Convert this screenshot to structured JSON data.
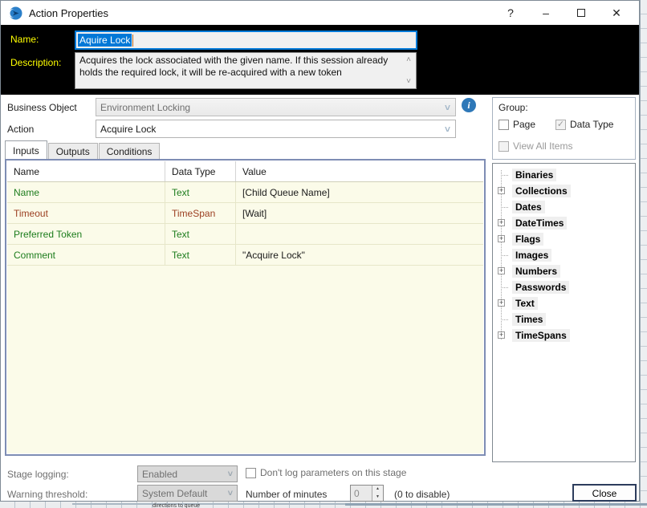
{
  "window": {
    "title": "Action Properties",
    "help": "?",
    "minimize": "–",
    "close": "✕"
  },
  "header": {
    "name_label": "Name:",
    "name_value": "Aquire Lock",
    "description_label": "Description:",
    "description_value": "Acquires the lock associated with the given name. If this session already holds the required lock, it will be re-acquired with a new token"
  },
  "form": {
    "business_object_label": "Business Object",
    "business_object_value": "Environment Locking",
    "action_label": "Action",
    "action_value": "Acquire Lock"
  },
  "tabs": [
    {
      "label": "Inputs",
      "active": true
    },
    {
      "label": "Outputs",
      "active": false
    },
    {
      "label": "Conditions",
      "active": false
    }
  ],
  "inputs_table": {
    "columns": [
      "Name",
      "Data Type",
      "Value"
    ],
    "rows": [
      {
        "name": "Name",
        "type": "Text",
        "value": "[Child Queue Name]",
        "color": "green"
      },
      {
        "name": "Timeout",
        "type": "TimeSpan",
        "value": "[Wait]",
        "color": "maroon"
      },
      {
        "name": "Preferred Token",
        "type": "Text",
        "value": "",
        "color": "green"
      },
      {
        "name": "Comment",
        "type": "Text",
        "value": "\"Acquire Lock\"",
        "color": "green"
      }
    ]
  },
  "group_panel": {
    "title": "Group:",
    "checkboxes": [
      {
        "label": "Page",
        "checked": false,
        "disabled": false
      },
      {
        "label": "Data Type",
        "checked": true,
        "disabled": true
      },
      {
        "label": "View All Items",
        "checked": false,
        "disabled": true
      }
    ]
  },
  "tree": {
    "items": [
      {
        "label": "Binaries",
        "expandable": false
      },
      {
        "label": "Collections",
        "expandable": true
      },
      {
        "label": "Dates",
        "expandable": false
      },
      {
        "label": "DateTimes",
        "expandable": true
      },
      {
        "label": "Flags",
        "expandable": true
      },
      {
        "label": "Images",
        "expandable": false
      },
      {
        "label": "Numbers",
        "expandable": true
      },
      {
        "label": "Passwords",
        "expandable": false
      },
      {
        "label": "Text",
        "expandable": true
      },
      {
        "label": "Times",
        "expandable": false
      },
      {
        "label": "TimeSpans",
        "expandable": true
      }
    ]
  },
  "footer": {
    "stage_logging_label": "Stage logging:",
    "stage_logging_value": "Enabled",
    "dont_log_label": "Don't log parameters on this stage",
    "warning_threshold_label": "Warning threshold:",
    "warning_threshold_value": "System Default",
    "number_of_minutes_label": "Number of minutes",
    "minutes_value": "0",
    "disable_hint": "(0 to disable)",
    "close_label": "Close"
  },
  "background": {
    "partial_text": "directions to queue"
  },
  "icons": {
    "check": "✓",
    "chevron_down": "˅",
    "scroll_up": "˄",
    "scroll_down": "˅",
    "plus": "+",
    "spin_up": "▲",
    "spin_down": "▼",
    "info": "i"
  },
  "colors": {
    "selection": "#0078d7",
    "header_bg": "#000000",
    "label_yellow": "#ffff00",
    "grid_bg": "#fbfbe9",
    "grid_border": "#7e8db4",
    "green_text": "#1c7c1c",
    "maroon_text": "#9c4022",
    "info_blue": "#2e78b8"
  }
}
